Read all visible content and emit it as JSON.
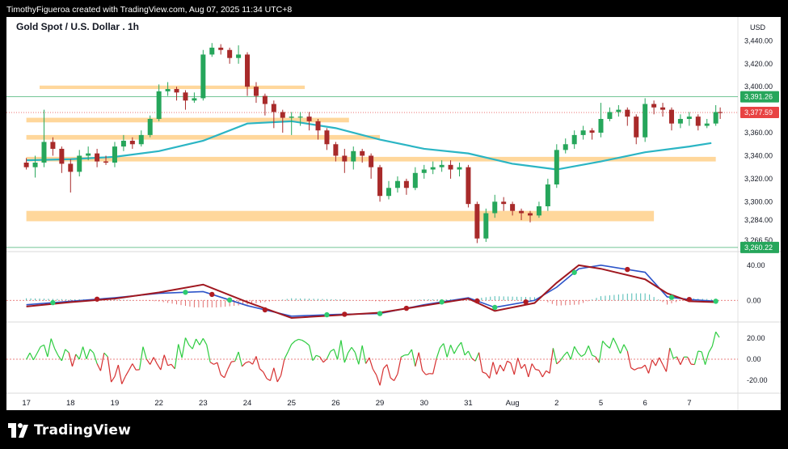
{
  "header": {
    "credit": "TimothyFigueroa created with TradingView.com, Aug 07, 2025 11:34 UTC+8"
  },
  "brand": {
    "name": "TradingView",
    "icon": "tradingview-logo-icon"
  },
  "chart_data": [
    {
      "type": "candlestick",
      "title": "Gold Spot / U.S. Dollar . 1h",
      "currency": "USD",
      "ylim": [
        3258,
        3448
      ],
      "y_ticks": [
        3440,
        3420,
        3400,
        3360,
        3340,
        3320,
        3300,
        3284,
        3266.5
      ],
      "y_tick_labels": [
        "3,440.00",
        "3,420.00",
        "3,400.00",
        "3,360.00",
        "3,340.00",
        "3,320.00",
        "3,300.00",
        "3,284.00",
        "3,266.50"
      ],
      "x_labels": [
        "17",
        "18",
        "19",
        "22",
        "23",
        "24",
        "25",
        "26",
        "29",
        "30",
        "31",
        "Aug",
        "2",
        "5",
        "6",
        "7"
      ],
      "price_tags": [
        {
          "value": 3391.26,
          "label": "3,391.26",
          "color": "#26a65b",
          "style": "horizontal-line"
        },
        {
          "value": 3377.59,
          "label": "3,377.59",
          "color": "#e84343",
          "style": "last-price"
        },
        {
          "value": 3260.22,
          "label": "3,260.22",
          "color": "#26a65b",
          "style": "horizontal-line"
        }
      ],
      "zones": [
        {
          "from_x": 0.3,
          "to_x": 6.3,
          "y_low": 3398,
          "y_high": 3401
        },
        {
          "from_x": 0,
          "to_x": 7.3,
          "y_low": 3369,
          "y_high": 3373
        },
        {
          "from_x": 0,
          "to_x": 8.0,
          "y_low": 3354,
          "y_high": 3358
        },
        {
          "from_x": 0,
          "to_x": 15.6,
          "y_low": 3335,
          "y_high": 3339
        },
        {
          "from_x": 0,
          "to_x": 14.2,
          "y_low": 3283,
          "y_high": 3292
        }
      ],
      "moving_average": {
        "color": "#2bb5c4",
        "points": [
          [
            0,
            3336
          ],
          [
            1,
            3337
          ],
          [
            2,
            3339
          ],
          [
            3,
            3344
          ],
          [
            4,
            3353
          ],
          [
            5,
            3368
          ],
          [
            6,
            3370
          ],
          [
            7,
            3364
          ],
          [
            8,
            3354
          ],
          [
            9,
            3346
          ],
          [
            10,
            3342
          ],
          [
            11,
            3333
          ],
          [
            12,
            3328
          ],
          [
            13,
            3335
          ],
          [
            14,
            3343
          ],
          [
            15,
            3348
          ],
          [
            15.5,
            3351
          ]
        ]
      },
      "candles": [
        [
          0,
          3334,
          3330,
          3338,
          3328
        ],
        [
          0.2,
          3330,
          3334,
          3340,
          3321
        ],
        [
          0.4,
          3334,
          3352,
          3380,
          3330
        ],
        [
          0.6,
          3352,
          3346,
          3356,
          3340
        ],
        [
          0.8,
          3346,
          3333,
          3348,
          3325
        ],
        [
          1.0,
          3333,
          3326,
          3337,
          3308
        ],
        [
          1.2,
          3326,
          3340,
          3345,
          3322
        ],
        [
          1.4,
          3340,
          3342,
          3348,
          3336
        ],
        [
          1.6,
          3342,
          3335,
          3346,
          3330
        ],
        [
          1.8,
          3335,
          3334,
          3340,
          3332
        ],
        [
          2.0,
          3334,
          3348,
          3352,
          3330
        ],
        [
          2.2,
          3348,
          3353,
          3358,
          3344
        ],
        [
          2.4,
          3353,
          3350,
          3356,
          3346
        ],
        [
          2.6,
          3350,
          3358,
          3362,
          3348
        ],
        [
          2.8,
          3358,
          3372,
          3375,
          3356
        ],
        [
          3.0,
          3372,
          3396,
          3402,
          3370
        ],
        [
          3.2,
          3396,
          3398,
          3404,
          3392
        ],
        [
          3.4,
          3398,
          3395,
          3400,
          3388
        ],
        [
          3.6,
          3395,
          3388,
          3397,
          3380
        ],
        [
          3.8,
          3388,
          3390,
          3395,
          3386
        ],
        [
          4.0,
          3390,
          3428,
          3432,
          3388
        ],
        [
          4.2,
          3428,
          3434,
          3438,
          3426
        ],
        [
          4.4,
          3434,
          3432,
          3437,
          3428
        ],
        [
          4.6,
          3432,
          3425,
          3434,
          3420
        ],
        [
          4.8,
          3425,
          3428,
          3436,
          3420
        ],
        [
          5.0,
          3428,
          3400,
          3430,
          3392
        ],
        [
          5.2,
          3400,
          3392,
          3404,
          3386
        ],
        [
          5.4,
          3392,
          3385,
          3394,
          3375
        ],
        [
          5.6,
          3385,
          3378,
          3388,
          3364
        ],
        [
          5.8,
          3378,
          3373,
          3380,
          3360
        ],
        [
          6.0,
          3373,
          3374,
          3378,
          3358
        ],
        [
          6.2,
          3374,
          3374,
          3378,
          3366
        ],
        [
          6.4,
          3374,
          3370,
          3378,
          3362
        ],
        [
          6.6,
          3370,
          3362,
          3372,
          3354
        ],
        [
          6.8,
          3362,
          3350,
          3364,
          3345
        ],
        [
          7.0,
          3350,
          3340,
          3352,
          3335
        ],
        [
          7.2,
          3340,
          3335,
          3346,
          3325
        ],
        [
          7.4,
          3335,
          3344,
          3348,
          3328
        ],
        [
          7.6,
          3344,
          3340,
          3346,
          3334
        ],
        [
          7.8,
          3340,
          3330,
          3342,
          3320
        ],
        [
          8.0,
          3330,
          3305,
          3332,
          3300
        ],
        [
          8.2,
          3305,
          3312,
          3318,
          3302
        ],
        [
          8.4,
          3312,
          3318,
          3322,
          3308
        ],
        [
          8.6,
          3318,
          3312,
          3320,
          3306
        ],
        [
          8.8,
          3312,
          3325,
          3330,
          3310
        ],
        [
          9.0,
          3325,
          3328,
          3332,
          3320
        ],
        [
          9.2,
          3328,
          3330,
          3335,
          3324
        ],
        [
          9.4,
          3330,
          3332,
          3336,
          3326
        ],
        [
          9.6,
          3332,
          3328,
          3336,
          3320
        ],
        [
          9.8,
          3328,
          3330,
          3334,
          3322
        ],
        [
          10.0,
          3330,
          3298,
          3332,
          3295
        ],
        [
          10.2,
          3298,
          3268,
          3300,
          3264
        ],
        [
          10.4,
          3268,
          3290,
          3294,
          3265
        ],
        [
          10.6,
          3290,
          3300,
          3306,
          3286
        ],
        [
          10.8,
          3300,
          3298,
          3304,
          3292
        ],
        [
          11.0,
          3298,
          3292,
          3300,
          3288
        ],
        [
          11.2,
          3292,
          3290,
          3294,
          3284
        ],
        [
          11.4,
          3290,
          3288,
          3292,
          3282
        ],
        [
          11.6,
          3288,
          3296,
          3300,
          3286
        ],
        [
          11.8,
          3296,
          3315,
          3320,
          3292
        ],
        [
          12.0,
          3315,
          3345,
          3350,
          3312
        ],
        [
          12.2,
          3345,
          3350,
          3355,
          3342
        ],
        [
          12.4,
          3350,
          3358,
          3362,
          3346
        ],
        [
          12.6,
          3358,
          3362,
          3366,
          3354
        ],
        [
          12.8,
          3362,
          3360,
          3364,
          3354
        ],
        [
          13.0,
          3360,
          3372,
          3386,
          3356
        ],
        [
          13.2,
          3372,
          3378,
          3382,
          3370
        ],
        [
          13.4,
          3378,
          3380,
          3384,
          3374
        ],
        [
          13.6,
          3380,
          3374,
          3382,
          3366
        ],
        [
          13.8,
          3374,
          3356,
          3376,
          3350
        ],
        [
          14.0,
          3356,
          3385,
          3390,
          3352
        ],
        [
          14.2,
          3385,
          3382,
          3388,
          3376
        ],
        [
          14.4,
          3382,
          3380,
          3386,
          3374
        ],
        [
          14.6,
          3380,
          3368,
          3382,
          3362
        ],
        [
          14.8,
          3368,
          3372,
          3376,
          3364
        ],
        [
          15.0,
          3372,
          3374,
          3378,
          3366
        ],
        [
          15.2,
          3374,
          3366,
          3376,
          3362
        ],
        [
          15.4,
          3366,
          3368,
          3372,
          3364
        ],
        [
          15.6,
          3368,
          3378,
          3384,
          3366
        ],
        [
          15.7,
          3378,
          3377.59,
          3382,
          3372
        ]
      ]
    },
    {
      "type": "line",
      "y_ticks": [
        40,
        0
      ],
      "y_tick_labels": [
        "40.00",
        "0.00"
      ],
      "ylim": [
        -20,
        50
      ],
      "series": [
        {
          "color": "#2c54c9",
          "points": [
            [
              0,
              -5
            ],
            [
              1,
              -1
            ],
            [
              2,
              3
            ],
            [
              3,
              8
            ],
            [
              4,
              10
            ],
            [
              5,
              -6
            ],
            [
              6,
              -18
            ],
            [
              7,
              -16
            ],
            [
              8,
              -15
            ],
            [
              9,
              -5
            ],
            [
              10,
              3
            ],
            [
              10.6,
              -8
            ],
            [
              11.5,
              0
            ],
            [
              12.0,
              15
            ],
            [
              12.5,
              36
            ],
            [
              13.0,
              40
            ],
            [
              14.0,
              32
            ],
            [
              14.5,
              4
            ],
            [
              15.0,
              1
            ],
            [
              15.6,
              -1
            ]
          ]
        },
        {
          "color": "#a01820",
          "points": [
            [
              0,
              -7
            ],
            [
              1,
              -2
            ],
            [
              2,
              2
            ],
            [
              3,
              9
            ],
            [
              4,
              18
            ],
            [
              5,
              -2
            ],
            [
              6,
              -20
            ],
            [
              7,
              -17
            ],
            [
              8,
              -14
            ],
            [
              9,
              -6
            ],
            [
              10,
              2
            ],
            [
              10.6,
              -12
            ],
            [
              11.5,
              -3
            ],
            [
              12.0,
              20
            ],
            [
              12.5,
              40
            ],
            [
              13.0,
              36
            ],
            [
              14.0,
              24
            ],
            [
              14.5,
              8
            ],
            [
              15.0,
              -1
            ],
            [
              15.6,
              -2
            ]
          ]
        }
      ],
      "crosses": [
        0.6,
        1.6,
        3.6,
        4.2,
        4.6,
        5.4,
        6.8,
        7.2,
        8.0,
        8.6,
        9.4,
        10.2,
        10.6,
        11.3,
        12.4,
        13.6,
        14.6,
        15.0,
        15.6
      ],
      "histogram": {
        "pos_color": "#1fa9a0",
        "neg_color": "#d94a4a"
      }
    },
    {
      "type": "line",
      "y_ticks": [
        20,
        0,
        -20
      ],
      "y_tick_labels": [
        "20.00",
        "0.00",
        "-20.00"
      ],
      "ylim": [
        -30,
        30
      ],
      "series_colors": {
        "positive": "#2ecc40",
        "negative": "#d63030"
      }
    }
  ]
}
